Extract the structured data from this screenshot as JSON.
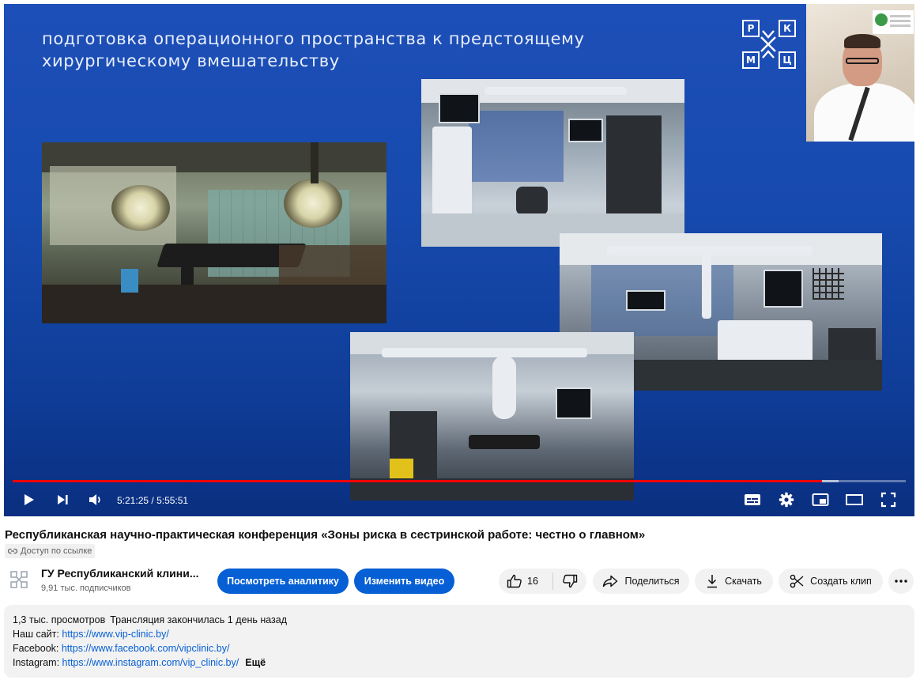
{
  "slide": {
    "title_line1": "подготовка операционного пространства к предстоящему",
    "title_line2": "хирургическому вмешательству",
    "logo_letters": [
      "Р",
      "К",
      "М",
      "Ц"
    ]
  },
  "player": {
    "time_current": "5:21:25",
    "time_separator": " / ",
    "time_total": "5:55:51",
    "progress_fraction": 0.906,
    "buffer_fraction": 0.925,
    "progress_color": "#ff0000",
    "icons": {
      "play": "play-icon",
      "next": "next-icon",
      "volume": "volume-icon",
      "subtitles": "subtitles-icon",
      "settings": "gear-icon",
      "miniplayer": "miniplayer-icon",
      "theater": "theater-icon",
      "fullscreen": "fullscreen-icon"
    }
  },
  "video": {
    "title": "Республиканская научно-практическая конференция «Зоны риска в сестринской работе: честно о главном»",
    "access_label": "Доступ по ссылке"
  },
  "channel": {
    "name": "ГУ Республиканский клини...",
    "subscribers": "9,91 тыс. подписчиков"
  },
  "actions": {
    "analytics_label": "Посмотреть аналитику",
    "edit_label": "Изменить видео",
    "like_count": "16",
    "share_label": "Поделиться",
    "download_label": "Скачать",
    "clip_label": "Создать клип",
    "accent_color": "#065fd4"
  },
  "description": {
    "views": "1,3 тыс. просмотров",
    "stream_status": "Трансляция закончилась 1 день назад",
    "site_label": "Наш сайт: ",
    "site_url": "https://www.vip-clinic.by/",
    "facebook_label": "Facebook: ",
    "facebook_url": "https://www.facebook.com/vipclinic.by/",
    "instagram_label": "Instagram: ",
    "instagram_url": "https://www.instagram.com/vip_clinic.by/",
    "more_label": "Ещё"
  }
}
